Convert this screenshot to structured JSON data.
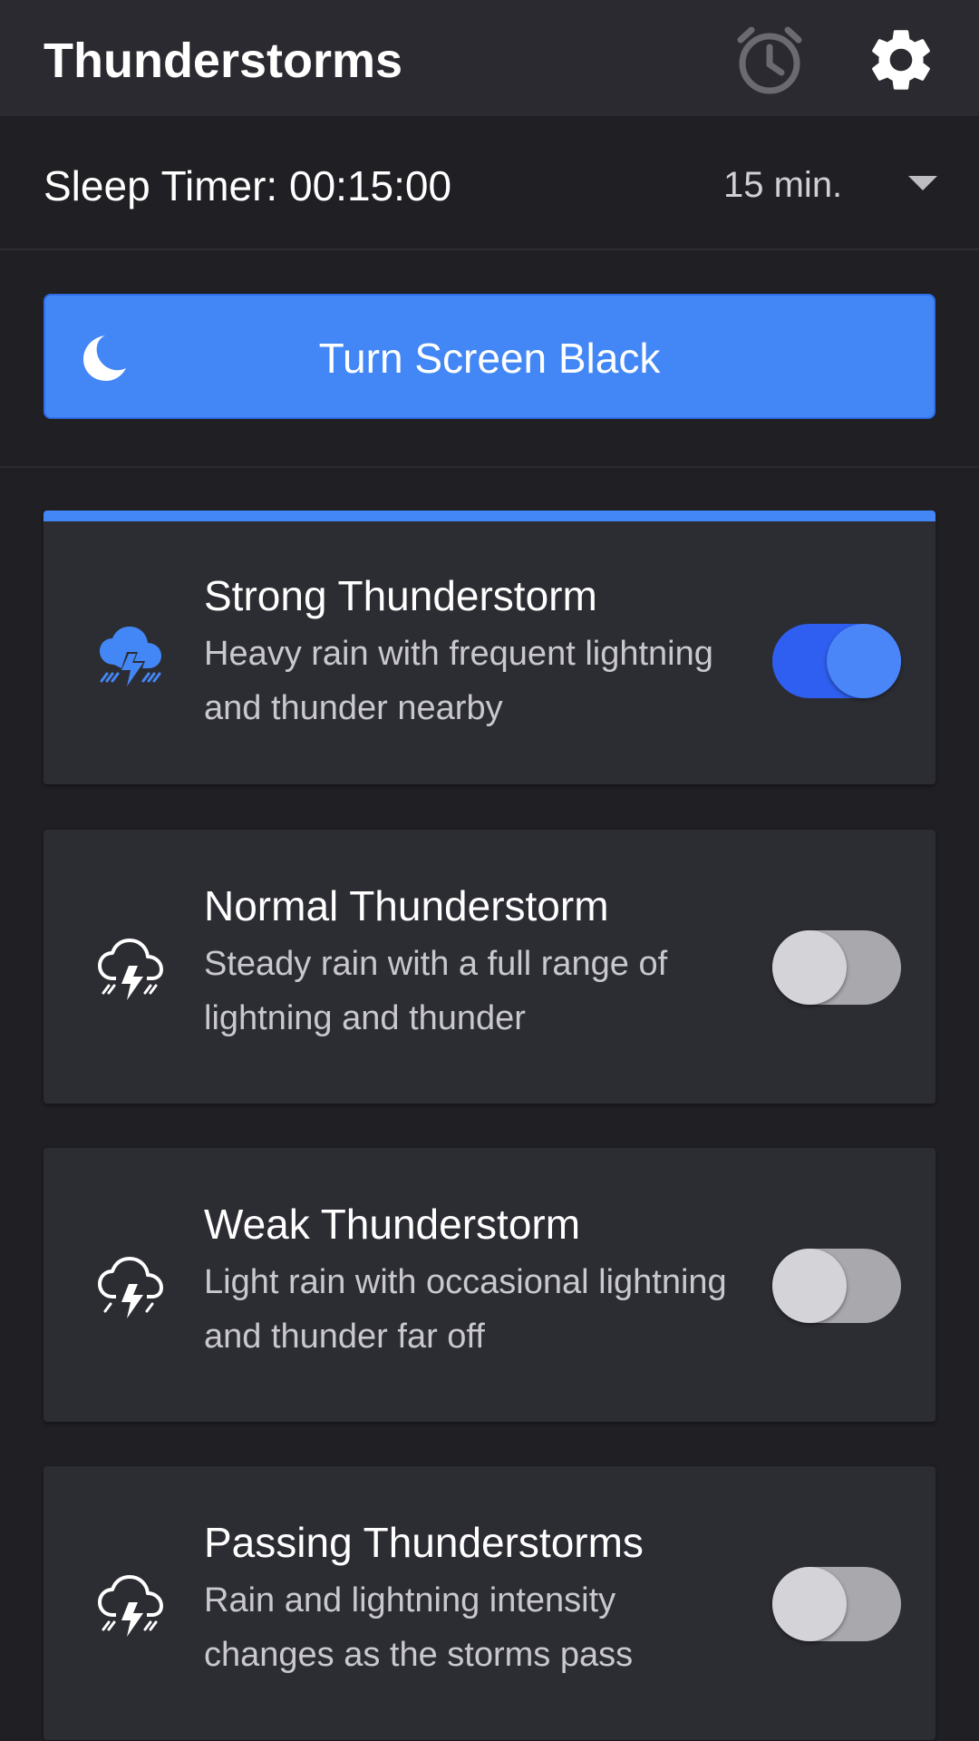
{
  "header": {
    "title": "Thunderstorms",
    "alarm_icon": "alarm-clock-icon",
    "settings_icon": "gear-icon"
  },
  "sleep_timer": {
    "label": "Sleep Timer: 00:15:00",
    "selected_option": "15 min."
  },
  "screen_black_button": {
    "label": "Turn Screen Black",
    "icon": "moon-icon"
  },
  "storms": [
    {
      "title": "Strong Thunderstorm",
      "description": "Heavy rain with frequent lightning and thunder nearby",
      "icon": "storm-cloud-icon",
      "enabled": true
    },
    {
      "title": "Normal Thunderstorm",
      "description": "Steady rain with a full range of lightning and thunder",
      "icon": "storm-cloud-icon",
      "enabled": false
    },
    {
      "title": "Weak Thunderstorm",
      "description": "Light rain with occasional lightning and thunder far off",
      "icon": "storm-cloud-icon",
      "enabled": false
    },
    {
      "title": "Passing Thunderstorms",
      "description": "Rain and lightning intensity changes as the storms pass",
      "icon": "storm-cloud-icon",
      "enabled": false
    }
  ],
  "colors": {
    "accent": "#4287f5",
    "background": "#1f1f24",
    "card": "#2c2c33",
    "appbar": "#2a2a30"
  }
}
